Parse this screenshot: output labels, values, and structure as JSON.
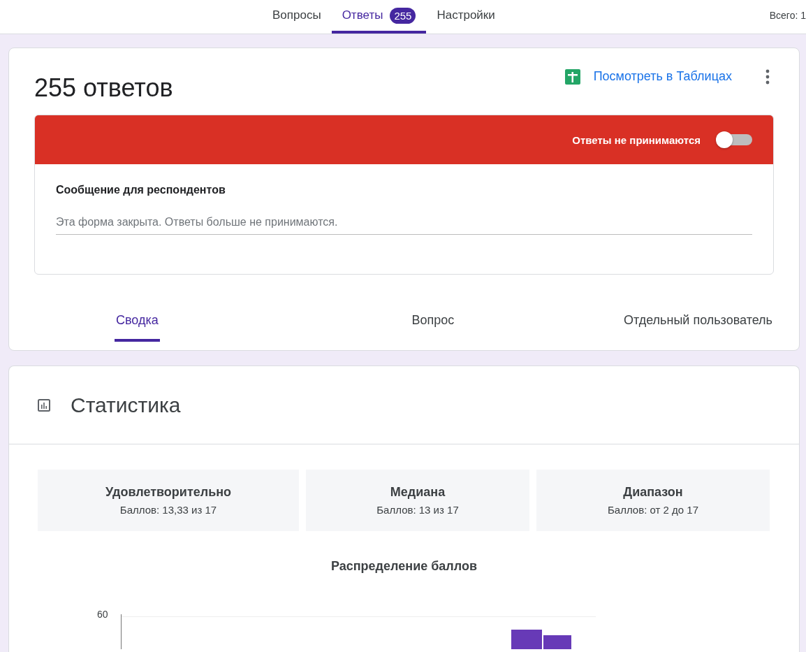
{
  "top_tabs": [
    {
      "label": "Вопросы",
      "selected": false
    },
    {
      "label": "Ответы",
      "selected": true,
      "badge": "255"
    },
    {
      "label": "Настройки",
      "selected": false
    }
  ],
  "total": "Всего: 1",
  "responses": {
    "title": "255 ответов",
    "sheets_link": "Посмотреть в Таблицах",
    "accepting": {
      "label": "Ответы не принимаются",
      "on": false
    },
    "message_label": "Сообщение для респондентов",
    "message": "Эта форма закрыта. Ответы больше не принимаются."
  },
  "view_tabs": [
    {
      "label": "Сводка",
      "selected": true
    },
    {
      "label": "Вопрос",
      "selected": false
    },
    {
      "label": "Отдельный пользователь",
      "selected": false
    }
  ],
  "stats": {
    "title": "Статистика",
    "cards": [
      {
        "title": "Удовлетворительно",
        "value": "Баллов: 13,33 из 17"
      },
      {
        "title": "Медиана",
        "value": "Баллов: 13 из 17"
      },
      {
        "title": "Диапазон",
        "value": "Баллов: от 2 до 17"
      }
    ],
    "chart_title": "Распределение баллов",
    "y_tick": "60"
  }
}
